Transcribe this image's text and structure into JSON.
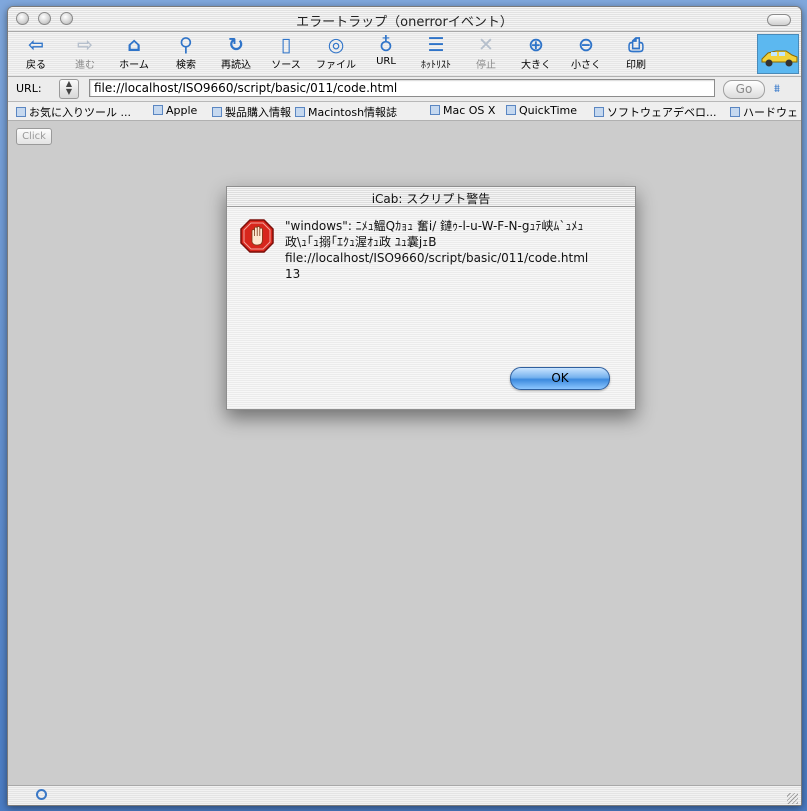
{
  "window": {
    "title": "エラートラップ（onerrorイベント）"
  },
  "toolbar": {
    "buttons": [
      {
        "label": "戻る",
        "icon": "back-arrow-icon",
        "glyph": "⇦",
        "enabled": true
      },
      {
        "label": "進む",
        "icon": "forward-arrow-icon",
        "glyph": "⇨",
        "enabled": false
      },
      {
        "label": "ホーム",
        "icon": "home-icon",
        "glyph": "⌂",
        "enabled": true
      },
      {
        "label": "検索",
        "icon": "search-icon",
        "glyph": "⚲",
        "enabled": true
      },
      {
        "label": "再読込",
        "icon": "reload-icon",
        "glyph": "↻",
        "enabled": true
      },
      {
        "label": "ソース",
        "icon": "source-document-icon",
        "glyph": "▯",
        "enabled": true
      },
      {
        "label": "ファイル",
        "icon": "file-target-icon",
        "glyph": "◎",
        "enabled": true
      },
      {
        "label": "URL",
        "icon": "url-globe-icon",
        "glyph": "♁",
        "enabled": true
      },
      {
        "label": "ﾎｯﾄﾘｽﾄ",
        "icon": "hotlist-icon",
        "glyph": "☰",
        "enabled": true
      },
      {
        "label": "停止",
        "icon": "stop-x-icon",
        "glyph": "✕",
        "enabled": false
      },
      {
        "label": "大きく",
        "icon": "zoom-in-plus-icon",
        "glyph": "⊕",
        "enabled": true
      },
      {
        "label": "小さく",
        "icon": "zoom-out-minus-icon",
        "glyph": "⊖",
        "enabled": true
      },
      {
        "label": "印刷",
        "icon": "print-icon",
        "glyph": "⎙",
        "enabled": true
      }
    ]
  },
  "urlbar": {
    "label": "URL:",
    "value": "file://localhost/ISO9660/script/basic/011/code.html",
    "go_label": "Go"
  },
  "bookmarks": [
    "お気に入りツール ...",
    "Apple",
    "製品購入情報",
    "Macintosh情報誌",
    "Mac OS X",
    "QuickTime",
    "ソフトウェアデベロ...",
    "ハードウェ"
  ],
  "page": {
    "click_button_label": "Click"
  },
  "dialog": {
    "title": "iCab: スクリプト警告",
    "message_lines": [
      "\"windows\": ﾆﾒｭ鰮Qｶｮｭ  奮i/  鏈ｩ-l-u-W-F-N-gｭﾃ峡ﾑ`ｭﾒｭ",
      "政\\ｭ｢ｭ搦｢ｴｸｭ渥ｵｭ政  ﾕｭ囊jｪB",
      "file://localhost/ISO9660/script/basic/011/code.html",
      "13"
    ],
    "ok_label": "OK",
    "icon": "stop-hand-icon"
  },
  "colors": {
    "desktop": "#4a7cc4",
    "toolbar_icon": "#2f74c9",
    "content_bg": "#cccccc",
    "ok_button": "#3c8ade",
    "stop_sign": "#d8261c"
  }
}
